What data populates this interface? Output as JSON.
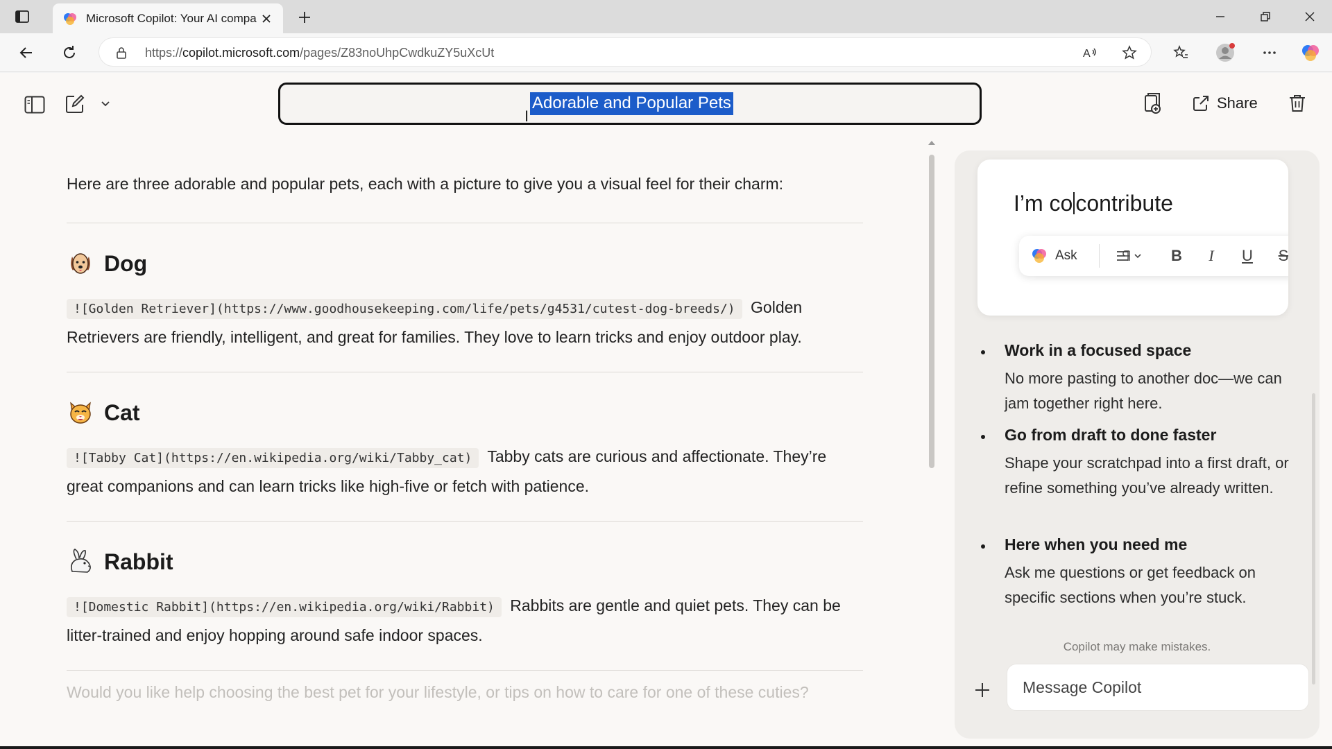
{
  "browser": {
    "tab_title": "Microsoft Copilot: Your AI compa",
    "url_prefix": "https://",
    "url_host": "copilot.microsoft.com",
    "url_path": "/pages/Z83noUhpCwdkuZY5uXcUt"
  },
  "page": {
    "header": {
      "title_field": "Adorable and Popular Pets",
      "share_label": "Share"
    },
    "document": {
      "intro": "Here are three adorable and popular pets, each with a picture to give you a visual feel for their charm:",
      "sections": [
        {
          "heading": "Dog",
          "code": "![Golden Retriever](https://www.goodhousekeeping.com/life/pets/g4531/cutest-dog-breeds/)",
          "text": "Golden Retrievers are friendly, intelligent, and great for families. They love to learn tricks and enjoy outdoor play."
        },
        {
          "heading": "Cat",
          "code": "![Tabby Cat](https://en.wikipedia.org/wiki/Tabby_cat)",
          "text": "Tabby cats are curious and affectionate. They’re great companions and can learn tricks like high-five or fetch with patience."
        },
        {
          "heading": "Rabbit",
          "code": "![Domestic Rabbit](https://en.wikipedia.org/wiki/Rabbit)",
          "text": "Rabbits are gentle and quiet pets. They can be litter-trained and enjoy hopping around safe indoor spaces."
        }
      ],
      "closing_question": "Would you like help choosing the best pet for your lifestyle, or tips on how to care for one of these cuties?"
    },
    "copilot_panel": {
      "draft_before_caret": "I’m co",
      "draft_after_caret": "contribute",
      "ask_label": "Ask",
      "bold_label": "B",
      "italic_label": "I",
      "underline_label": "U",
      "strike_label": "S",
      "bullets": [
        {
          "title": "Work in a focused space",
          "body": "No more pasting to another doc—we can jam together right here."
        },
        {
          "title": "Go from draft to done faster",
          "body": "Shape your scratchpad into a first draft, or refine something you’ve already written."
        },
        {
          "title": "Here when you need me",
          "body": "Ask me questions or get feedback on specific sections when you’re stuck."
        }
      ],
      "disclaimer": "Copilot may make mistakes.",
      "message_placeholder": "Message Copilot"
    }
  },
  "colors": {
    "selection": "#1c5cc9",
    "page_bg": "#faf8f6",
    "panel_bg": "#efedea"
  }
}
